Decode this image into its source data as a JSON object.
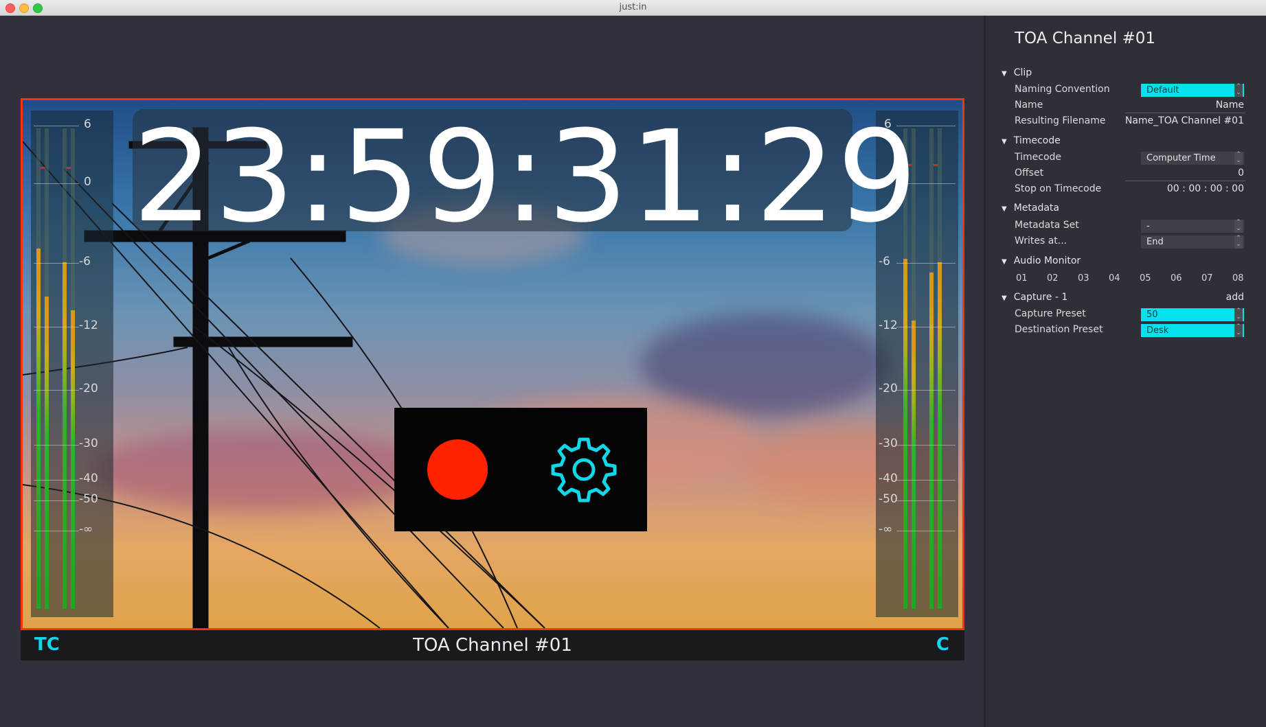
{
  "window": {
    "title": "just:in"
  },
  "timecode": "23:59:31:29",
  "meter_scale": [
    "6",
    "0",
    "-6",
    "-12",
    "-20",
    "-30",
    "-40",
    "-50",
    "-∞"
  ],
  "left_meter": {
    "levels": [
      0.75,
      0.65,
      0.72,
      0.62
    ],
    "peaks": [
      0.85,
      0.0,
      0.85,
      0.0
    ]
  },
  "right_meter": {
    "levels": [
      0.73,
      0.6,
      0.7,
      0.72
    ],
    "peaks": [
      0.86,
      0.0,
      0.86,
      0.0
    ]
  },
  "controls": {
    "record": "record-button",
    "settings": "gear-icon",
    "record_color": "#ff2200",
    "accent": "#11d8e8"
  },
  "bottom_bar": {
    "left": "TC",
    "title": "TOA Channel #01",
    "right": "C"
  },
  "panel": {
    "title": "TOA Channel #01",
    "clip": {
      "header": "Clip",
      "naming_convention_label": "Naming Convention",
      "naming_convention_value": "Default",
      "name_label": "Name",
      "name_value": "Name",
      "resulting_filename_label": "Resulting Filename",
      "resulting_filename_value": "Name_TOA Channel #01"
    },
    "timecode": {
      "header": "Timecode",
      "timecode_label": "Timecode",
      "timecode_value": "Computer Time",
      "offset_label": "Offset",
      "offset_value": "0",
      "stop_label": "Stop on Timecode",
      "stop_value": "00 : 00 : 00 : 00"
    },
    "metadata": {
      "header": "Metadata",
      "set_label": "Metadata Set",
      "set_value": "-",
      "writes_label": "Writes at...",
      "writes_value": "End"
    },
    "audio_monitor": {
      "header": "Audio Monitor",
      "channels": [
        "01",
        "02",
        "03",
        "04",
        "05",
        "06",
        "07",
        "08"
      ]
    },
    "capture": {
      "header": "Capture - 1",
      "add_label": "add",
      "preset_label": "Capture Preset",
      "preset_value": "50",
      "destination_label": "Destination Preset",
      "destination_value": "Desk"
    }
  }
}
